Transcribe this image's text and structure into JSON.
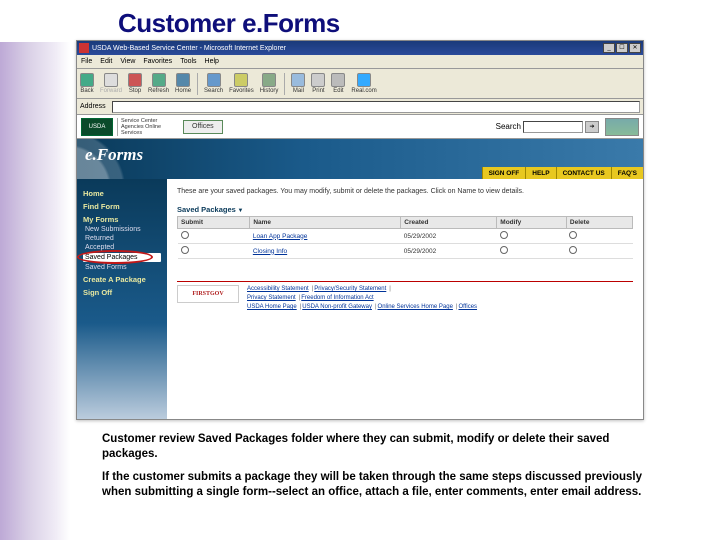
{
  "slide": {
    "title": "Customer e.Forms",
    "caption1": "Customer review Saved Packages folder where they can submit, modify or delete their saved packages.",
    "caption2": "If the customer submits a package they will be taken through the same steps discussed previously when submitting a single form--select an office, attach a file, enter comments, enter email address."
  },
  "browser": {
    "title": "USDA Web-Based Service Center - Microsoft Internet Explorer",
    "menu": {
      "file": "File",
      "edit": "Edit",
      "view": "View",
      "favorites": "Favorites",
      "tools": "Tools",
      "help": "Help"
    },
    "buttons": {
      "back": "Back",
      "forward": "Forward",
      "stop": "Stop",
      "refresh": "Refresh",
      "home": "Home",
      "search": "Search",
      "favorites": "Favorites",
      "history": "History",
      "mail": "Mail",
      "print": "Print",
      "edit": "Edit",
      "realcom": "Real.com"
    },
    "address_label": "Address",
    "address_value": ""
  },
  "header": {
    "usda": "USDA",
    "sca": "Service Center Agencies Online Services",
    "offices_tab": "Offices",
    "search_label": "Search",
    "go": "➔"
  },
  "hero": {
    "logo": "e.Forms"
  },
  "ybar": {
    "signoff": "SIGN OFF",
    "help": "HELP",
    "contact": "CONTACT US",
    "faqs": "FAQ'S"
  },
  "sidebar": {
    "home": "Home",
    "find_form": "Find Form",
    "my_forms": "My Forms",
    "items": [
      {
        "label": "New Submissions"
      },
      {
        "label": "Returned"
      },
      {
        "label": "Accepted"
      },
      {
        "label": "Saved Packages",
        "selected": true
      },
      {
        "label": "Saved Forms"
      }
    ],
    "create": "Create A Package",
    "signoff": "Sign Off"
  },
  "main": {
    "intro": "These are your saved packages. You may modify, submit or delete the packages. Click on Name to view details.",
    "table_title": "Saved Packages",
    "cols": {
      "submit": "Submit",
      "name": "Name",
      "created": "Created",
      "modify": "Modify",
      "delete": "Delete"
    },
    "rows": [
      {
        "name": "Loan App Package",
        "created": "05/29/2002"
      },
      {
        "name": "Closing Info",
        "created": "05/29/2002"
      }
    ]
  },
  "footer": {
    "firstgov": "FIRSTGOV",
    "line1": [
      "Accessibility Statement",
      "Privacy/Security Statement"
    ],
    "line2": [
      "Privacy Statement",
      "Freedom of Information Act"
    ],
    "line3": [
      "USDA Home Page",
      "USDA Non-profit Gateway",
      "Online Services Home Page",
      "Offices"
    ]
  }
}
